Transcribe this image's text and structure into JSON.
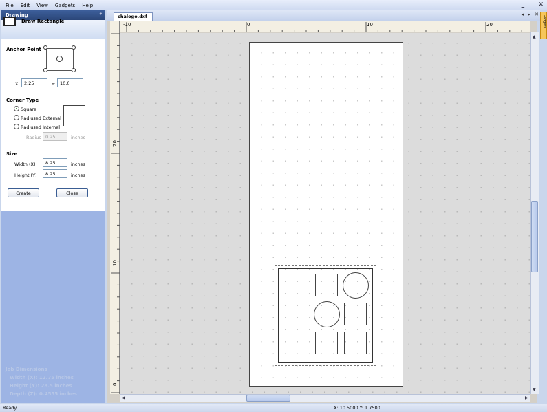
{
  "menu": [
    "File",
    "Edit",
    "View",
    "Gadgets",
    "Help"
  ],
  "window_controls": "_ ▫ ✕",
  "panel": {
    "title": "Drawing",
    "pin": "ᵠ",
    "tool": "Draw Rectangle",
    "anchor_point_label": "Anchor Point",
    "x_label": "X:",
    "x_value": "2.25",
    "y_label": "Y:",
    "y_value": "10.0",
    "corner_type_label": "Corner Type",
    "corner_options": [
      "Square",
      "Radiused External",
      "Radiused Internal"
    ],
    "corner_selected": "Square",
    "radius_label": "Radius",
    "radius_value": "0.25",
    "radius_unit": "inches",
    "size_label": "Size",
    "width_label": "Width (X)",
    "width_value": "8.25",
    "width_unit": "inches",
    "height_label": "Height (Y)",
    "height_value": "8.25",
    "height_unit": "inches",
    "create_button": "Create",
    "close_button": "Close"
  },
  "job_dimensions": {
    "title": "Job Dimensions",
    "width": "Width  (X): 12.75 inches",
    "height": "Height (Y): 28.5 inches",
    "depth": "Depth  (Z): 0.4555 inches"
  },
  "document": {
    "tab": "chalogo.dxf",
    "tab_controls": "◂ ▸ ✕",
    "side_tab": "Gadgets"
  },
  "rulers": {
    "h_labels": [
      "-10",
      "0",
      "10",
      "20"
    ],
    "v_labels": [
      "20",
      "10",
      "0"
    ]
  },
  "status": {
    "text": "Ready",
    "coords": "X: 10.5000 Y: 1.7500"
  },
  "colors": {
    "panel_title": "#2b4678",
    "panel_bg": "#9db4e4",
    "canvas": "#dcdcdc",
    "side_tab": "#f6c65a"
  }
}
